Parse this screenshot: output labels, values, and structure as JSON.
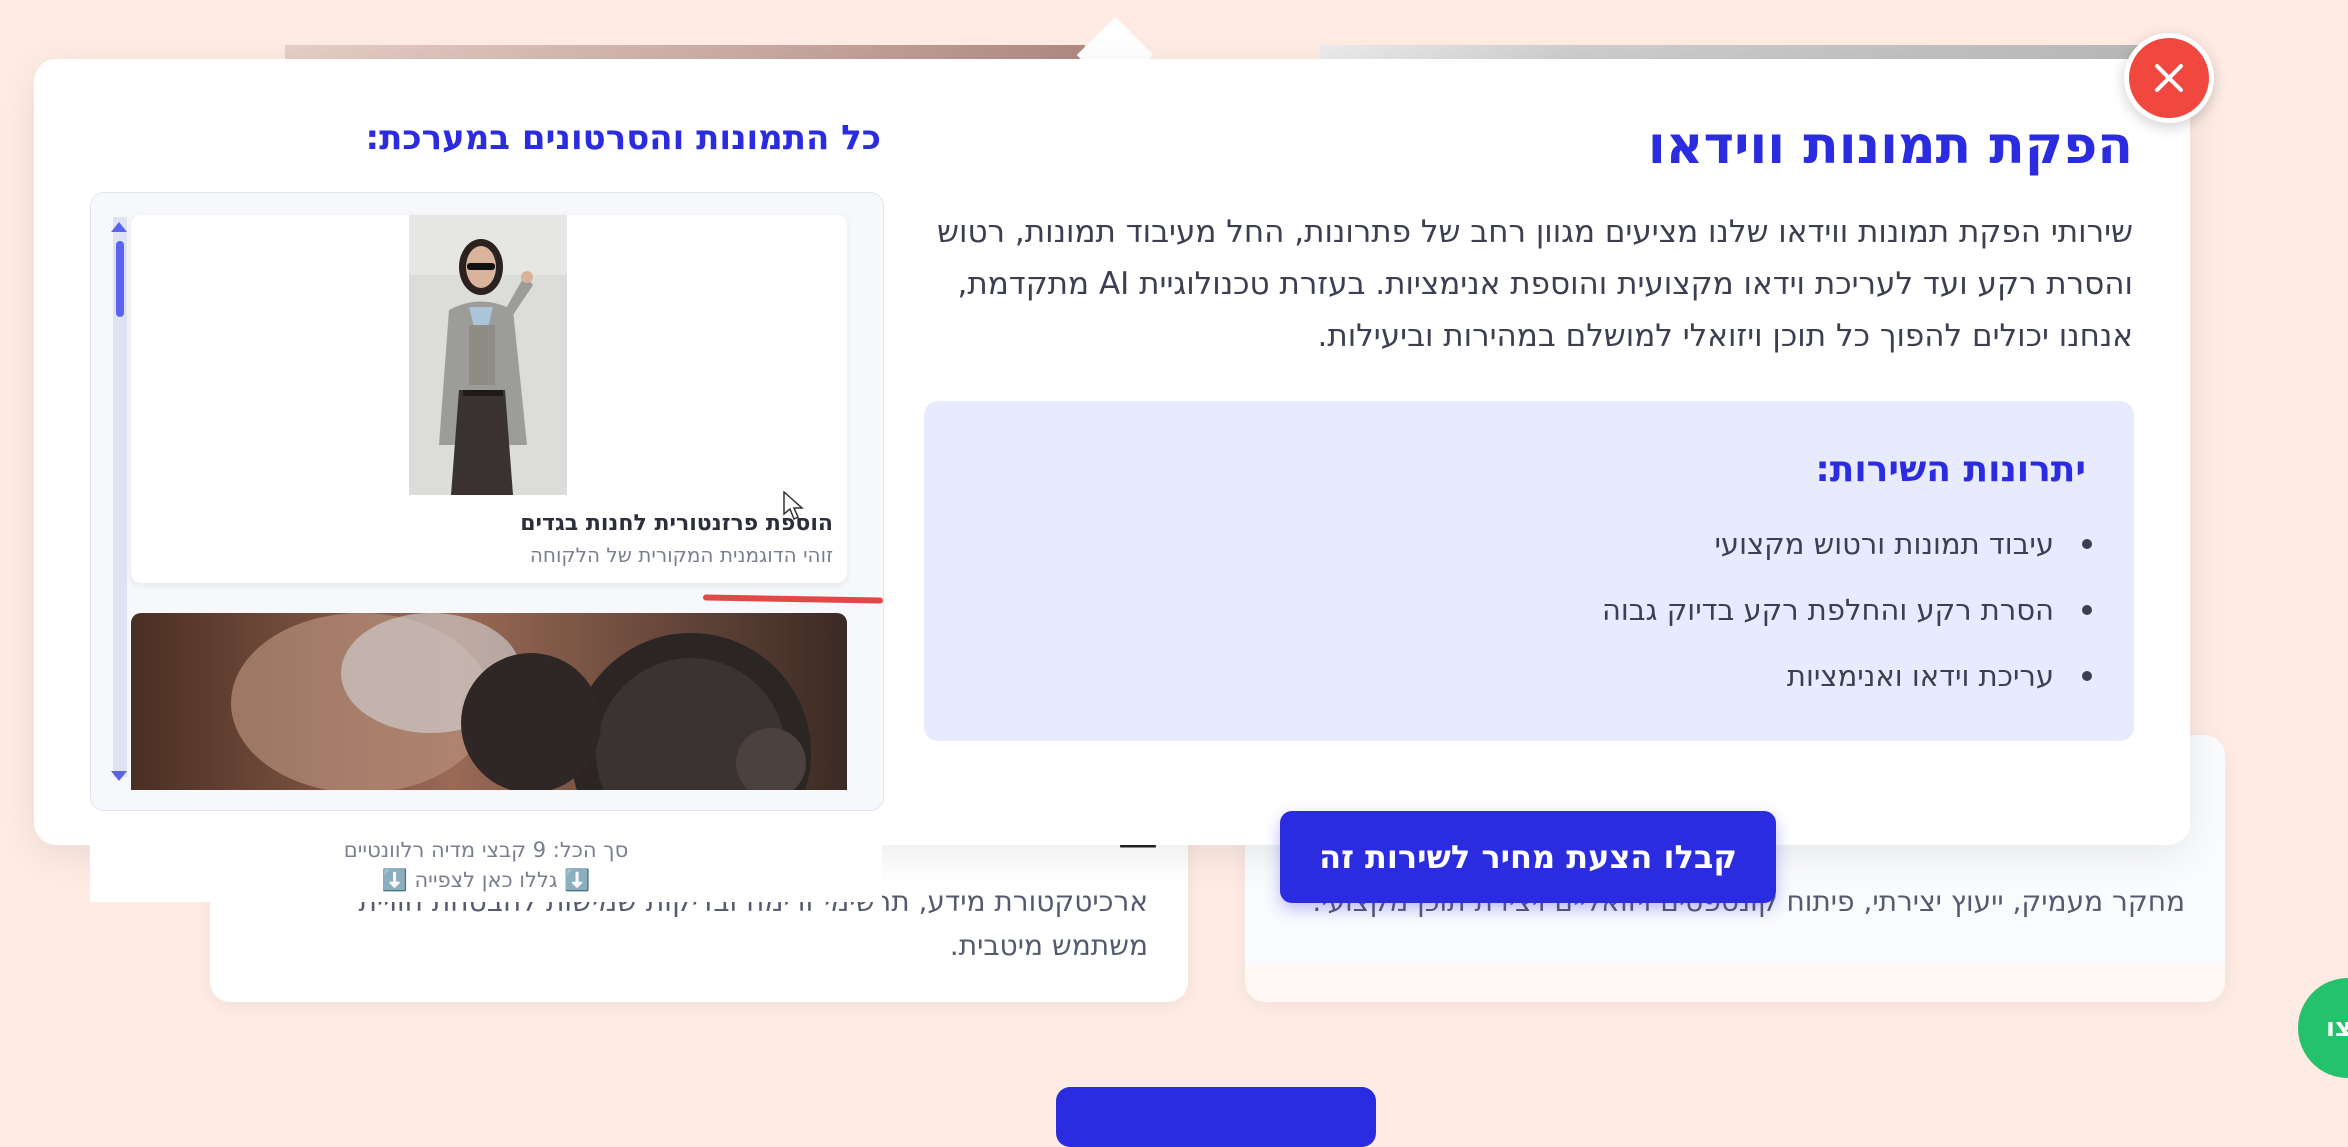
{
  "modal": {
    "title": "הפקת תמונות ווידאו",
    "description": "שירותי הפקת תמונות ווידאו שלנו מציעים מגוון רחב של פתרונות, החל מעיבוד תמונות, רטוש והסרת רקע ועד לעריכת וידאו מקצועית והוספת אנימציות. בעזרת טכנולוגיית AI מתקדמת, אנחנו יכולים להפוך כל תוכן ויזואלי למושלם במהירות וביעילות.",
    "benefits_title": "יתרונות השירות:",
    "benefits": [
      "עיבוד תמונות ורטוש מקצועי",
      "הסרת רקע והחלפת רקע בדיוק גבוה",
      "עריכת וידאו ואנימציות"
    ],
    "cta_label": "קבלו הצעת מחיר לשירות זה",
    "close_icon": "close-icon"
  },
  "gallery": {
    "title": "כל התמונות והסרטונים במערכת:",
    "items": [
      {
        "title": "הוספת פרזנטורית לחנות בגדים",
        "subtitle": "זוהי הדוגמנית המקורית של הלקוחה"
      }
    ],
    "total_text": "סך הכל: 9 קבצי מדיה רלוונטיים",
    "browse_text": "⬇️ גללו כאן לצפייה ⬇️"
  },
  "background": {
    "left_card_text": "ארכיטקטורת מידע, תרשימי זרימה ובדיקות שמישות להבטחת חוויית משתמש מיטבית.",
    "right_card_text": "מחקר מעמיק, ייעוץ יצירתי, פיתוח קונספטים ויזואליים ויצירת תוכן מקצועי.",
    "whatsapp_label": "צו"
  },
  "colors": {
    "accent": "#2b2be0",
    "close": "#f0483e",
    "benefits_bg": "#e8ebfd",
    "page_bg": "#fdebe4"
  }
}
